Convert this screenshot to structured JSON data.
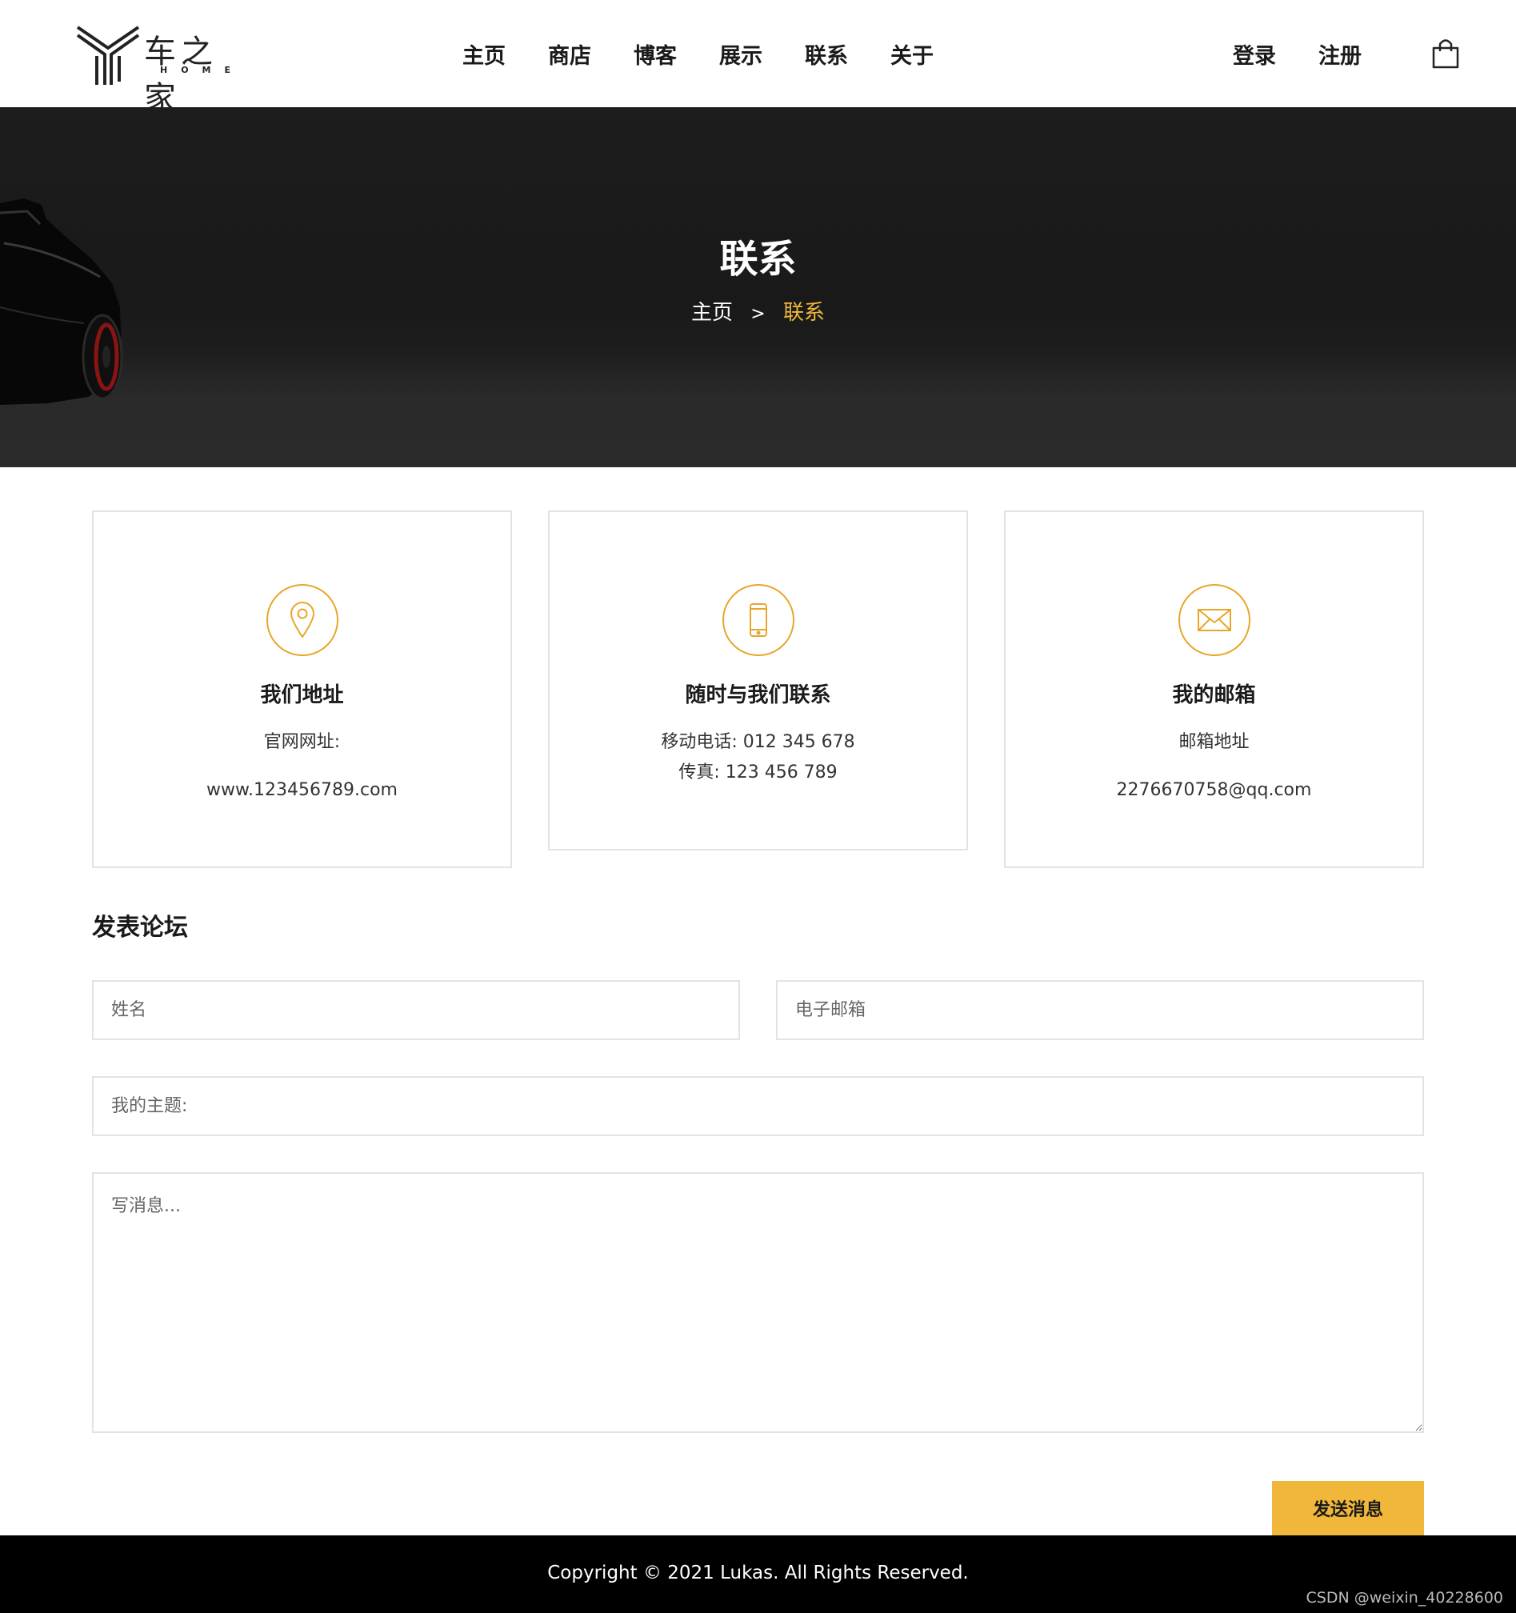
{
  "header": {
    "logo": {
      "title": "车之家",
      "subtitle": "HOME"
    },
    "nav": [
      "主页",
      "商店",
      "博客",
      "展示",
      "联系",
      "关于"
    ],
    "account": {
      "login": "登录",
      "register": "注册"
    }
  },
  "banner": {
    "title": "联系",
    "breadcrumb": {
      "home": "主页",
      "separator": ">",
      "current": "联系"
    }
  },
  "cards": {
    "address": {
      "title": "我们地址",
      "line1": "官网网址:",
      "line2": "www.123456789.com"
    },
    "phone": {
      "title": "随时与我们联系",
      "line1": "移动电话: 012 345 678",
      "line2": "传真: 123 456 789"
    },
    "email": {
      "title": "我的邮箱",
      "line1": "邮箱地址",
      "line2": "2276670758@qq.com"
    }
  },
  "form": {
    "title": "发表论坛",
    "name_placeholder": "姓名",
    "email_placeholder": "电子邮箱",
    "subject_placeholder": "我的主题:",
    "message_placeholder": "写消息...",
    "submit_label": "发送消息"
  },
  "footer": {
    "copyright": "Copyright © 2021 Lukas. All Rights Reserved.",
    "watermark": "CSDN @weixin_40228600"
  },
  "colors": {
    "accent": "#f1b73a",
    "icon_stroke": "#e8a72c",
    "banner_bg": "#1b1b1b",
    "footer_bg": "#000000",
    "card_border": "#e3e3e3"
  },
  "icons": [
    "shopping-bag-icon",
    "map-pin-icon",
    "mobile-phone-icon",
    "envelope-icon"
  ]
}
